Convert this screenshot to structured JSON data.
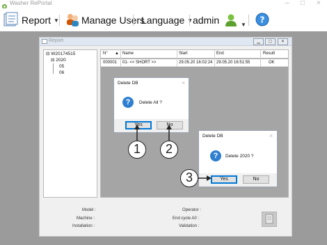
{
  "app": {
    "title": "Washer RePortal"
  },
  "menu": {
    "report": "Report",
    "manage_users": "Manage Users",
    "language": "Language",
    "admin": "admin"
  },
  "report_window": {
    "title": "Report"
  },
  "tree": {
    "root": "W20174515",
    "year": "2020",
    "months": [
      "05",
      "06"
    ]
  },
  "table": {
    "columns": [
      "N°",
      "Name",
      "Start",
      "End",
      "Result"
    ],
    "rows": [
      [
        "000001",
        "01- << SHORT >>",
        "29.05.20 16:02:24",
        "29.05.20 16:51:55",
        "OK"
      ]
    ]
  },
  "dialog1": {
    "title": "Delete DB",
    "message": "Delete All ?",
    "yes": "Yes",
    "no": "No"
  },
  "dialog2": {
    "title": "Delete DB",
    "message": "Delete 2020 ?",
    "yes": "Yes",
    "no": "No"
  },
  "callouts": [
    "1",
    "2",
    "3"
  ],
  "details": {
    "model": "Model :",
    "machine": "Machine :",
    "installation": "Installation :",
    "operator": "Operator :",
    "end_cycle": "End cycle A0 :",
    "validation": "Validation :"
  },
  "colors": {
    "accent": "#2f7fd1",
    "workspace": "#9b9b9b",
    "default_button_border": "#0078d7"
  }
}
